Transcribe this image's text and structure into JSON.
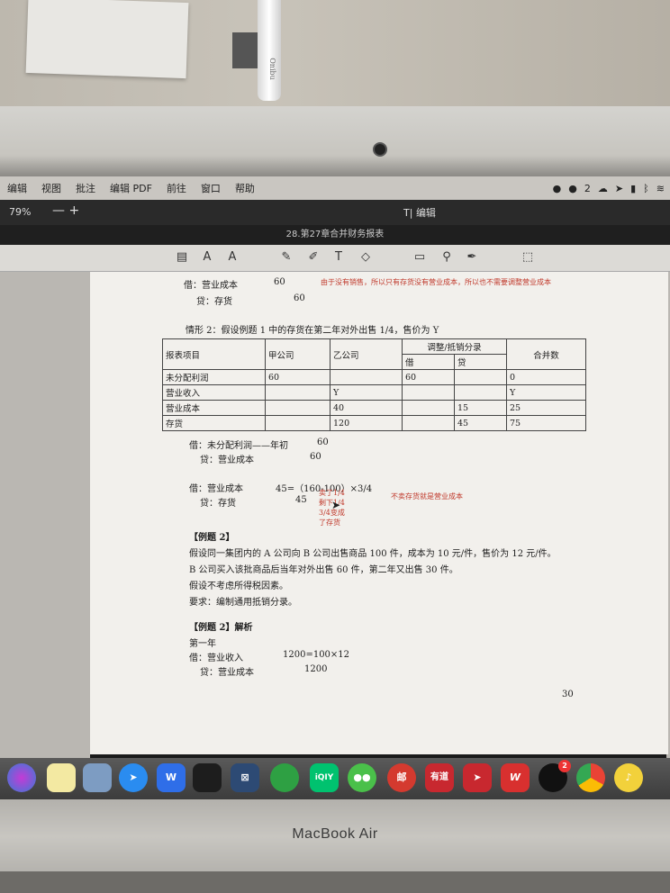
{
  "photo": {
    "pen_brand": "Onibu",
    "laptop_brand": "MacBook Air"
  },
  "menubar": {
    "items": [
      "编辑",
      "视图",
      "批注",
      "编辑 PDF",
      "前往",
      "窗口",
      "帮助"
    ],
    "status_text": "2"
  },
  "toolbar": {
    "zoom": "79%",
    "zoom_minus": "—",
    "zoom_plus": "+",
    "edit_label": "编辑",
    "window_title": "28.第27章合并财务报表"
  },
  "document": {
    "line1_label": "借：营业成本",
    "line1_value": "60",
    "line2_label": "贷：存货",
    "line2_value": "60",
    "note1": "由于没有销售，所以只有存货没有营业成本，所以也不需要调整营业成本",
    "situation2": "情形 2：假设例题 1 中的存货在第二年对外出售 1/4，售价为 Y",
    "table": {
      "headers": [
        "报表项目",
        "甲公司",
        "乙公司",
        "调整/抵销分录",
        "合并数"
      ],
      "subheaders": [
        "借",
        "贷"
      ],
      "rows": [
        [
          "未分配利润",
          "60",
          "",
          "60",
          "",
          "0"
        ],
        [
          "营业收入",
          "",
          "Y",
          "",
          "",
          "Y"
        ],
        [
          "营业成本",
          "",
          "40",
          "",
          "15",
          "25"
        ],
        [
          "存货",
          "",
          "120",
          "",
          "45",
          "75"
        ]
      ]
    },
    "entry1a": "借：未分配利润——年初",
    "entry1a_value": "60",
    "entry1b": "贷：营业成本",
    "entry1b_value": "60",
    "entry2a": "借：营业成本",
    "entry2a_value": "45=（160-100）×3/4",
    "entry2b": "贷：存货",
    "entry2b_value": "45",
    "handwritten": [
      "卖了1/4",
      "剩下1/4",
      "3/4变成",
      "了存货"
    ],
    "note2": "不卖存货就是营业成本",
    "example2_title": "【例题 2】",
    "example2_p1": "假设同一集团内的 A 公司向 B 公司出售商品 100 件，成本为 10 元/件，售价为 12 元/件。",
    "example2_p2": "B 公司买入该批商品后当年对外出售 60 件，第二年又出售 30 件。",
    "example2_p3": "假设不考虑所得税因素。",
    "example2_p4": "要求：编制通用抵销分录。",
    "analysis_title": "【例题 2】解析",
    "year1": "第一年",
    "entry3a": "借：营业收入",
    "entry3a_value": "1200=100×12",
    "entry3b": "贷：营业成本",
    "entry3b_value": "1200",
    "page_number": "30"
  },
  "dock": {
    "icons": [
      "siri-icon",
      "notes-icon",
      "preview-icon",
      "feishu-icon",
      "wps-icon",
      "reader-icon",
      "kindle-icon",
      "terminal-icon",
      "evernote-icon",
      "iqiyi-icon",
      "wechat-icon",
      "mail-icon",
      "youdao-icon",
      "infuse-icon",
      "wps-pdf-icon",
      "qq-icon",
      "chrome-icon",
      "music-icon"
    ],
    "labels": {
      "iqiyi": "iQIY",
      "youdao": "有道",
      "mail": "邮",
      "wps": "W",
      "qq_badge": "2"
    }
  }
}
